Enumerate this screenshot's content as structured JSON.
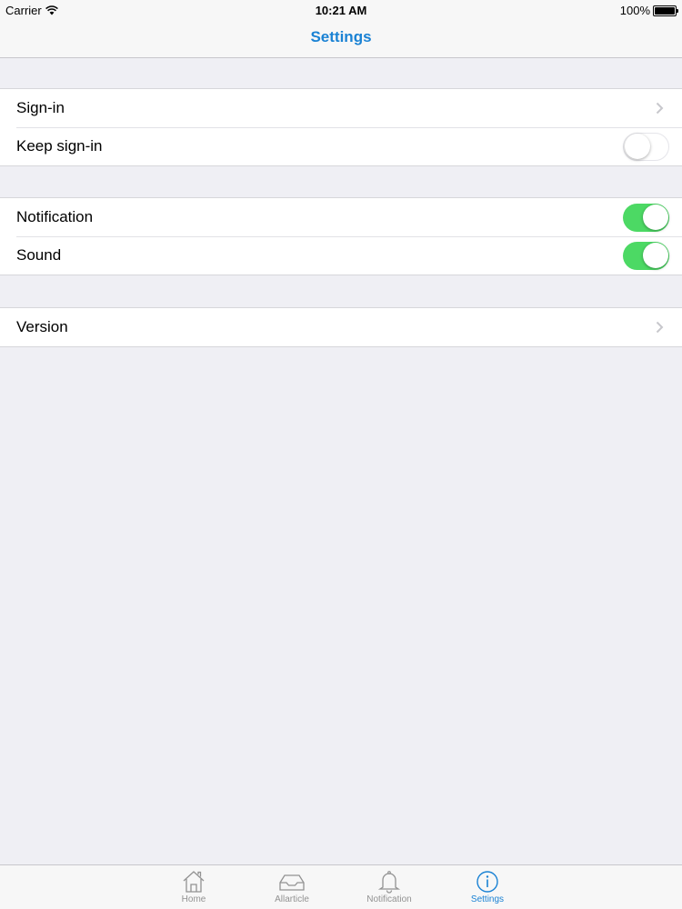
{
  "status_bar": {
    "carrier": "Carrier",
    "time": "10:21 AM",
    "battery": "100%"
  },
  "nav": {
    "title": "Settings"
  },
  "groups": [
    {
      "cells": [
        {
          "label": "Sign-in",
          "accessory": "chevron"
        },
        {
          "label": "Keep sign-in",
          "accessory": "toggle",
          "value": false
        }
      ]
    },
    {
      "cells": [
        {
          "label": "Notification",
          "accessory": "toggle",
          "value": true
        },
        {
          "label": "Sound",
          "accessory": "toggle",
          "value": true
        }
      ]
    },
    {
      "cells": [
        {
          "label": "Version",
          "accessory": "chevron"
        }
      ]
    }
  ],
  "tabs": [
    {
      "label": "Home",
      "icon": "home-icon"
    },
    {
      "label": "Allarticle",
      "icon": "inbox-icon"
    },
    {
      "label": "Notification",
      "icon": "bell-icon"
    },
    {
      "label": "Settings",
      "icon": "info-icon",
      "active": true
    }
  ],
  "colors": {
    "accent": "#1a82d4",
    "toggle_on": "#4cd964",
    "background": "#efeff4",
    "tab_inactive": "#929292"
  }
}
